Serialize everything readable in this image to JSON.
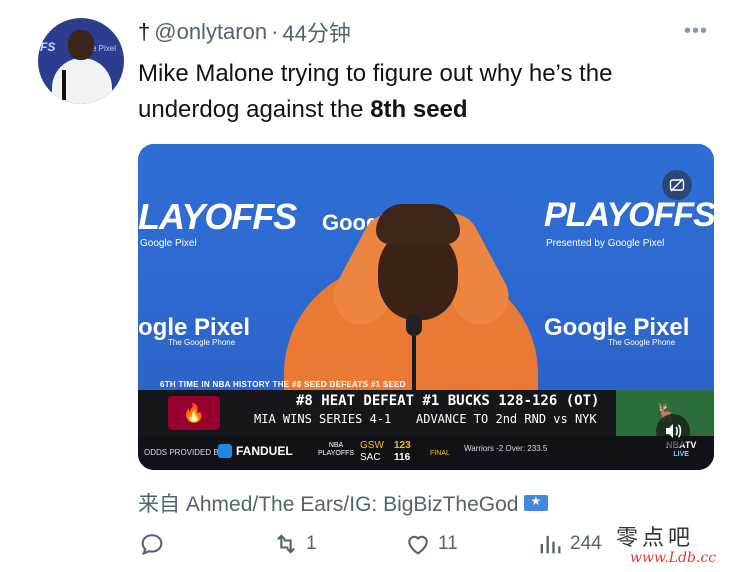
{
  "tweet": {
    "dagger": "†",
    "handle": "@onlytaron",
    "separator": "·",
    "time": "44分钟",
    "more": "•••",
    "text_part1": "Mike Malone trying to figure out why he’s the underdog against the ",
    "text_bold": "8th seed"
  },
  "avatar": {
    "bg_text": "FS",
    "bg_text2": "e Pixel"
  },
  "media": {
    "backdrop": {
      "brand1": "LAYOFFS",
      "brand1_sub": "Google Pixel",
      "brand2": "Google Pixel",
      "brand3": "PLAYOFFS",
      "brand3_sub": "Presented by Google Pixel",
      "brand4": "ogle Pixel",
      "brand4_sub": "The Google Phone",
      "brand5": "Google Pixel",
      "brand5_sub": "The Google Phone"
    },
    "ticker": {
      "top_note": "6TH TIME IN NBA HISTORY THE #8 SEED DEFEATS #1 SEED",
      "headline": "#8 HEAT DEFEAT #1 BUCKS 128-126 (OT)",
      "sub_left": "MIA WINS SERIES 4-1",
      "sub_right": "ADVANCE TO 2nd RND vs NYK"
    },
    "bottom_bar": {
      "odds_label": "ODDS PROVIDED BY",
      "sponsor": "FANDUEL",
      "league_top": "NBA",
      "league_bottom": "PLAYOFFS",
      "team1": "GSW",
      "score1": "123",
      "team2": "SAC",
      "score2": "116",
      "status": "FINAL",
      "odds_line": "Warriors -2   Over: 233.5",
      "network": "NBATV",
      "live": "LIVE"
    }
  },
  "attribution": {
    "text": "来自 Ahmed/The Ears/IG: BigBizTheGod"
  },
  "actions": {
    "replies": "",
    "retweets": "1",
    "likes": "11",
    "views": "244"
  },
  "watermark": {
    "line1": "零点吧",
    "line2": "www.Ldb.cc"
  },
  "colors": {
    "text_primary": "#0f1419",
    "text_secondary": "#536471",
    "heat_red": "#98002e",
    "bucks_green": "#2b6e3b",
    "banner_blue": "#2e6fd6"
  }
}
